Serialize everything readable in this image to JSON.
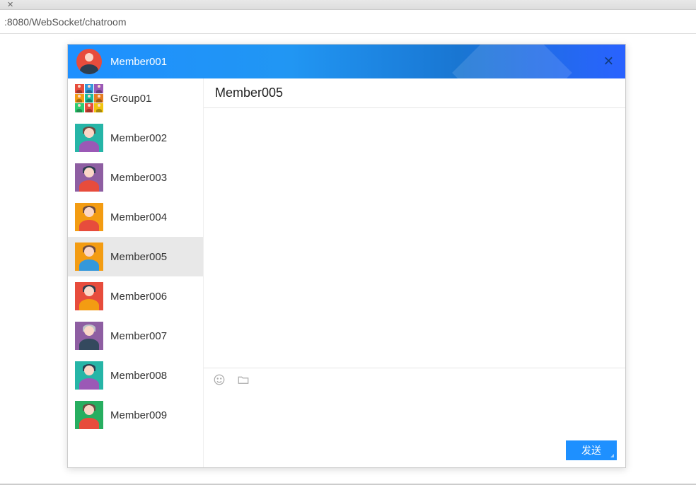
{
  "browser": {
    "url": ":8080/WebSocket/chatroom"
  },
  "header": {
    "current_user": "Member001"
  },
  "sidebar": {
    "items": [
      {
        "label": "Group01",
        "type": "group",
        "selected": false
      },
      {
        "label": "Member002",
        "type": "member",
        "avatar_bg": "avatar-teal",
        "body": "body-purple",
        "hair": "hair-brown",
        "selected": false
      },
      {
        "label": "Member003",
        "type": "member",
        "avatar_bg": "avatar-purple",
        "body": "body-red",
        "hair": "hair-black",
        "selected": false
      },
      {
        "label": "Member004",
        "type": "member",
        "avatar_bg": "avatar-orange",
        "body": "body-red",
        "hair": "hair-brown",
        "selected": false
      },
      {
        "label": "Member005",
        "type": "member",
        "avatar_bg": "avatar-orange",
        "body": "body-blue",
        "hair": "hair-brown",
        "selected": true
      },
      {
        "label": "Member006",
        "type": "member",
        "avatar_bg": "avatar-red",
        "body": "body-orange",
        "hair": "hair-black",
        "selected": false
      },
      {
        "label": "Member007",
        "type": "member",
        "avatar_bg": "avatar-purple",
        "body": "body-dark",
        "hair": "hair-gray",
        "selected": false
      },
      {
        "label": "Member008",
        "type": "member",
        "avatar_bg": "avatar-teal",
        "body": "body-purple",
        "hair": "hair-black",
        "selected": false
      },
      {
        "label": "Member009",
        "type": "member",
        "avatar_bg": "avatar-green",
        "body": "body-red",
        "hair": "hair-brown",
        "selected": false
      }
    ]
  },
  "chat": {
    "active_contact": "Member005",
    "input_value": "",
    "send_label": "发送"
  }
}
